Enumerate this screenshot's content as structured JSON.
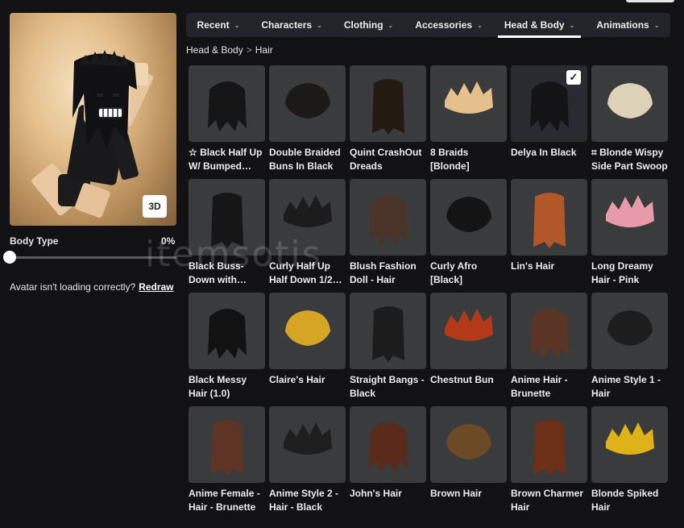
{
  "nav": {
    "tabs": [
      {
        "label": "Recent"
      },
      {
        "label": "Characters"
      },
      {
        "label": "Clothing"
      },
      {
        "label": "Accessories"
      },
      {
        "label": "Head & Body",
        "active": true
      },
      {
        "label": "Animations"
      }
    ]
  },
  "breadcrumb": {
    "parent": "Head & Body",
    "current": "Hair",
    "separator": ">"
  },
  "preview": {
    "view_button": "3D"
  },
  "body_type": {
    "label": "Body Type",
    "value": "0%",
    "level": 0
  },
  "loading": {
    "text": "Avatar isn't loading correctly?",
    "link": "Redraw"
  },
  "watermark": "itemsotis",
  "items": [
    {
      "name": "☆ Black Half Up W/ Bumped…",
      "color": "#151515"
    },
    {
      "name": "Double Braided Buns In Black",
      "color": "#1c1a19"
    },
    {
      "name": "Quint CrashOut Dreads LightSk…",
      "color": "#231a12"
    },
    {
      "name": "8 Braids [Blonde]",
      "color": "#e5c08c"
    },
    {
      "name": "Delya In Black",
      "color": "#141417",
      "equipped": true
    },
    {
      "name": "⌗ Blonde Wispy Side Part Swoop",
      "color": "#ddd2b8"
    },
    {
      "name": "Black Buss-Down with…",
      "color": "#161616"
    },
    {
      "name": "Curly Half Up Half Down 1/2…",
      "color": "#1b1b1b"
    },
    {
      "name": "Blush Fashion Doll - Hair",
      "color": "#4a3328"
    },
    {
      "name": "Curly Afro [Black]",
      "color": "#141414"
    },
    {
      "name": "Lin's Hair",
      "color": "#b2572a"
    },
    {
      "name": "Long Dreamy Hair - Pink",
      "color": "#e79aaa"
    },
    {
      "name": "Black Messy Hair (1.0)",
      "color": "#121212"
    },
    {
      "name": "Claire's Hair",
      "color": "#d6a526"
    },
    {
      "name": "Straight Bangs - Black",
      "color": "#1c1c1c"
    },
    {
      "name": "Chestnut Bun",
      "color": "#b23a18"
    },
    {
      "name": "Anime Hair - Brunette",
      "color": "#5a3424"
    },
    {
      "name": "Anime Style 1 - Hair",
      "color": "#1d1d1d"
    },
    {
      "name": "Anime Female - Hair - Brunette",
      "color": "#5e3524"
    },
    {
      "name": "Anime Style 2 - Hair - Black",
      "color": "#1e1e1e"
    },
    {
      "name": "John's Hair",
      "color": "#5a2a1a"
    },
    {
      "name": "Brown Hair",
      "color": "#6b4a25"
    },
    {
      "name": "Brown Charmer Hair",
      "color": "#6c3019"
    },
    {
      "name": "Blonde Spiked Hair",
      "color": "#e0b21a"
    }
  ]
}
